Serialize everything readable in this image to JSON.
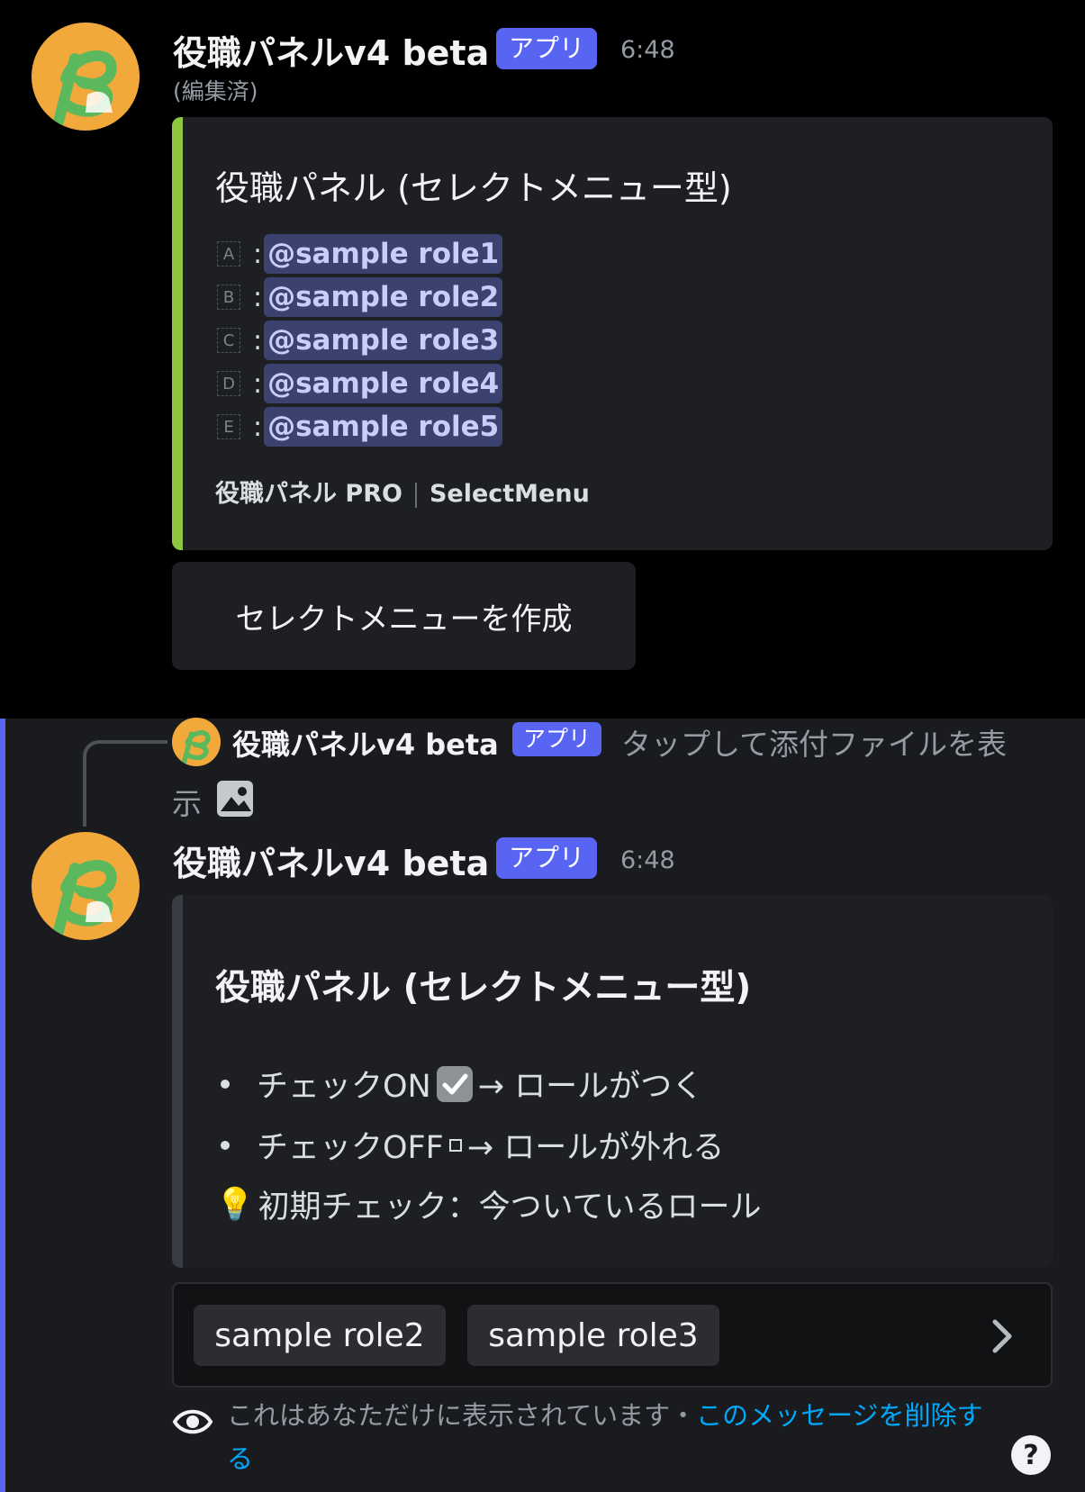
{
  "message1": {
    "author": "役職パネルv4 beta",
    "badge": "アプリ",
    "time": "6:48",
    "edited": "(編集済)",
    "embed": {
      "accent_color": "#8dc63f",
      "title": "役職パネル (セレクトメニュー型)",
      "roles": [
        {
          "letter": "A",
          "colon": ":",
          "mention": "@sample role1"
        },
        {
          "letter": "B",
          "colon": ":",
          "mention": "@sample role2"
        },
        {
          "letter": "C",
          "colon": ":",
          "mention": "@sample role3"
        },
        {
          "letter": "D",
          "colon": ":",
          "mention": "@sample role4"
        },
        {
          "letter": "E",
          "colon": ":",
          "mention": "@sample role5"
        }
      ],
      "footer_left": "役職パネル PRO",
      "footer_right": "SelectMenu"
    },
    "button_label": "セレクトメニューを作成"
  },
  "reply": {
    "author": "役職パネルv4 beta",
    "badge": "アプリ",
    "text_line1": "タップして添付ファイルを表",
    "text_line2": "示",
    "icon": "image-icon"
  },
  "message2": {
    "author": "役職パネルv4 beta",
    "badge": "アプリ",
    "time": "6:48",
    "embed": {
      "title": "役職パネル (セレクトメニュー型)",
      "bullet1_a": "チェックON",
      "bullet1_b": "→ ロールがつく",
      "bullet2_a": "チェックOFF",
      "bullet2_b": "→ ロールが外れる",
      "tip_icon": "💡",
      "tip": "初期チェック：今ついているロール"
    },
    "select": {
      "selected": [
        "sample role2",
        "sample role3"
      ]
    },
    "notice_text": "これはあなただけに表示されています・",
    "notice_link_1": "このメッセージを削除す",
    "notice_link_2": "る",
    "help": "?"
  },
  "colors": {
    "brand": "#5865f2",
    "embed_accent": "#8dc63f",
    "avatar": "#f2a93b"
  }
}
